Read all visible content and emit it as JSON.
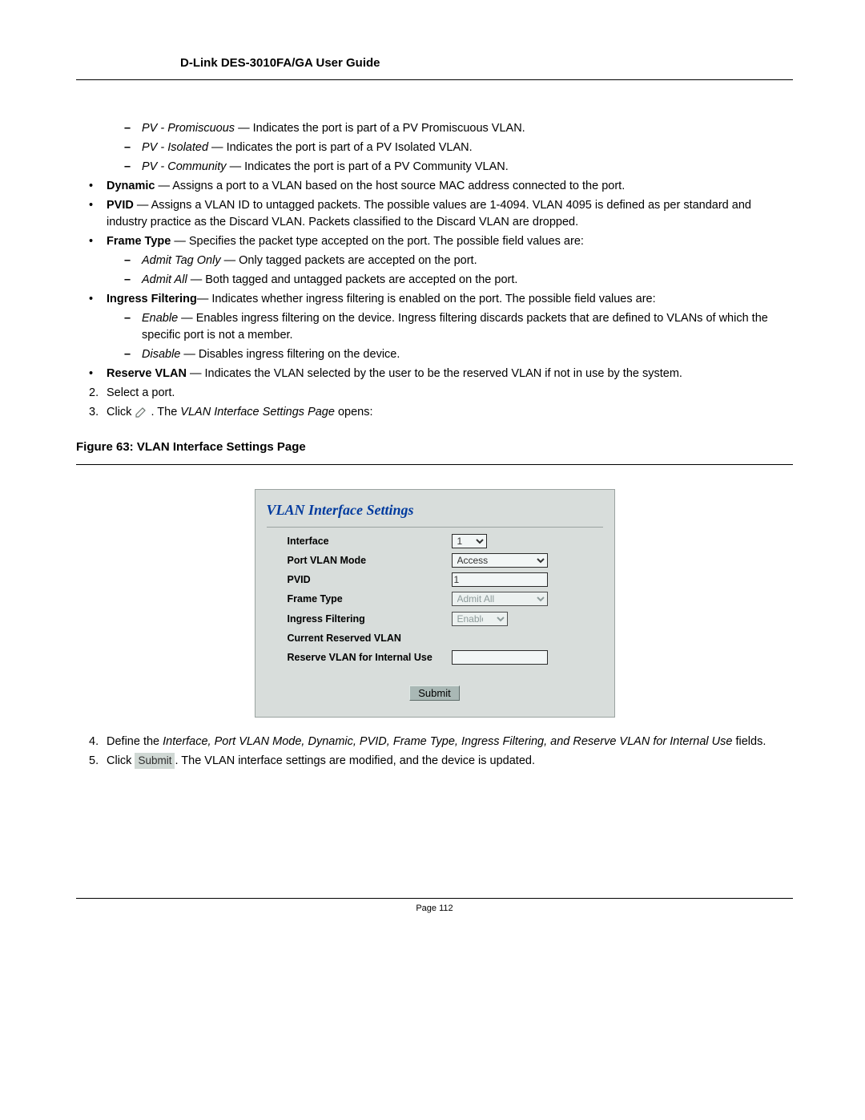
{
  "header": {
    "title": "D-Link DES-3010FA/GA User Guide"
  },
  "defs": {
    "pv_prom_term": "PV - Promiscuous",
    "pv_prom_desc": " — Indicates the port is part of a PV Promiscuous VLAN.",
    "pv_isol_term": "PV - Isolated",
    "pv_isol_desc": " — Indicates the port is part of a PV Isolated VLAN.",
    "pv_comm_term": "PV - Community",
    "pv_comm_desc": " — Indicates the port is part of a PV Community VLAN.",
    "dynamic_term": "Dynamic",
    "dynamic_desc": " — Assigns a port to a VLAN based on the host source MAC address connected to the port.",
    "pvid_term": "PVID",
    "pvid_desc": " — Assigns a VLAN ID to untagged packets. The possible values are 1-4094. VLAN 4095 is defined as per standard and industry practice as the Discard VLAN. Packets classified to the Discard VLAN are dropped.",
    "frametype_term": "Frame Type",
    "frametype_desc": " — Specifies the packet type accepted on the port. The possible field values are:",
    "admit_tag_term": "Admit Tag Only",
    "admit_tag_desc": " — Only tagged packets are accepted on the port.",
    "admit_all_term": "Admit All",
    "admit_all_desc": " — Both tagged and untagged packets are accepted on the port.",
    "ingress_term": "Ingress Filtering",
    "ingress_desc": "— Indicates whether ingress filtering is enabled on the port. The possible field values are:",
    "enable_term": "Enable",
    "enable_desc": " — Enables ingress filtering on the device. Ingress filtering discards packets that are defined to VLANs of which the specific port is not a member.",
    "disable_term": "Disable",
    "disable_desc": " — Disables ingress filtering on the device.",
    "reserve_term": "Reserve VLAN",
    "reserve_desc": " — Indicates the VLAN selected by the user to be the reserved VLAN if not in use by the system."
  },
  "steps": {
    "s2": "Select a port.",
    "s3_a": "Click ",
    "s3_b": " . The ",
    "s3_c": "VLAN Interface Settings Page",
    "s3_d": " opens:",
    "s4_a": "Define the ",
    "s4_fields": [
      "Interface",
      "Port VLAN Mode",
      "Dynamic",
      "PVID",
      "Frame Type",
      "Ingress Filtering",
      "Reserve VLAN for Internal Use"
    ],
    "s4_b": " fields.",
    "s5_a": "Click ",
    "s5_btn": "Submit",
    "s5_b": ". The VLAN interface settings are modified, and the device is updated."
  },
  "figure": {
    "caption": "Figure 63:  VLAN Interface Settings Page",
    "title": "VLAN Interface Settings",
    "labels": {
      "interface": "Interface",
      "mode": "Port VLAN Mode",
      "pvid": "PVID",
      "frame": "Frame Type",
      "ingress": "Ingress Filtering",
      "curr": "Current Reserved VLAN",
      "reserve": "Reserve VLAN for Internal Use"
    },
    "values": {
      "interface": "1",
      "mode": "Access",
      "pvid": "1",
      "frame": "Admit All",
      "ingress": "Enable",
      "reserve": ""
    },
    "submit": "Submit"
  },
  "footer": {
    "page": "Page 112"
  }
}
